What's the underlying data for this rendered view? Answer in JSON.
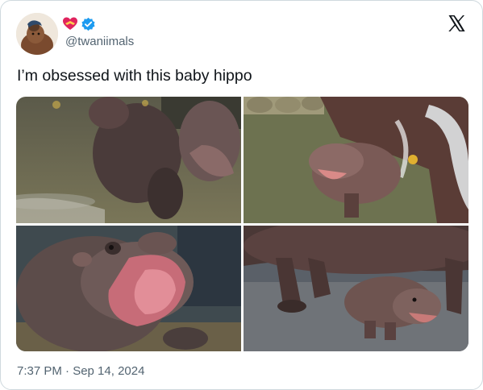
{
  "tweet": {
    "handle": "@twaniimals",
    "text": "I’m obsessed with this baby hippo",
    "timestamp": "7:37 PM · Sep 14, 2024",
    "badges": [
      "heart-with-ribbon-emoji",
      "verified-check"
    ],
    "media_count": 4
  },
  "icons": {
    "platform": "x-logo-icon",
    "verified": "verified-badge-icon",
    "emoji": "heart-with-ribbon-icon"
  },
  "colors": {
    "text": "#0f1419",
    "secondary_text": "#536471",
    "border": "#cfd9de",
    "verified_blue": "#1d9bf0",
    "emoji_red": "#e0245e"
  }
}
